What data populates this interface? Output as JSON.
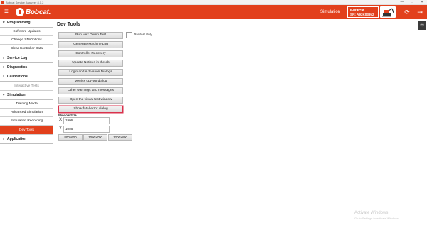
{
  "window": {
    "title": "Bobcat Service Analyzer 8.1.2",
    "controls": {
      "minimize": "—",
      "maximize": "□",
      "close": "✕"
    }
  },
  "header": {
    "menu_icon": "hamburger-icon",
    "logo_text": "Bobcat.",
    "simulation_label": "Simulation",
    "machine_model": "E35-E+M",
    "serial_number": "SN: A93K03952",
    "icons": [
      "excavator-image",
      "refresh-icon",
      "exit-icon"
    ],
    "accent_color": "#e2401c"
  },
  "sidebar": {
    "sections": [
      {
        "label": "Programming",
        "expanded": true,
        "items": [
          "Software Updates",
          "Change SN/Options",
          "Clear Controller Data"
        ]
      },
      {
        "label": "Service Log",
        "expanded": false,
        "items": []
      },
      {
        "label": "Diagnostics",
        "expanded": false,
        "items": []
      },
      {
        "label": "Calibrations",
        "expanded": false,
        "items": []
      },
      {
        "label": "Interactive Tests",
        "disabled": true,
        "items": []
      },
      {
        "label": "Simulation",
        "expanded": true,
        "items": [
          "Training Mode",
          "Advanced Simulation",
          "Simulation Recording",
          "Dev Tools"
        ]
      },
      {
        "label": "Application",
        "expanded": false,
        "items": []
      }
    ],
    "active_item": "Dev Tools"
  },
  "main": {
    "title": "Dev Tools",
    "buttons": [
      "Run Hex Dump Test",
      "Generate Machine Log",
      "Controller Recovery",
      "Update Notices in the db",
      "Login and Activation Dialogs",
      "Metrics opt-out dialog",
      "Other warnings and messages",
      "Open the visual test window",
      "Show fatal-error dialog"
    ],
    "highlighted_button": "Show fatal-error dialog",
    "manifest_only_label": "Manifest Only",
    "manifest_only_checked": false,
    "window_size": {
      "label": "Window Size",
      "x_label": "X",
      "x_value": "1906",
      "y_label": "Y",
      "y_value": "1056",
      "presets": [
        "800x600",
        "1000x700",
        "1200x800"
      ]
    }
  },
  "right_rail": {
    "zoom_icon": "zoom-out-icon"
  },
  "watermark": {
    "title": "Activate Windows",
    "subtitle": "Go to Settings to activate Windows."
  }
}
